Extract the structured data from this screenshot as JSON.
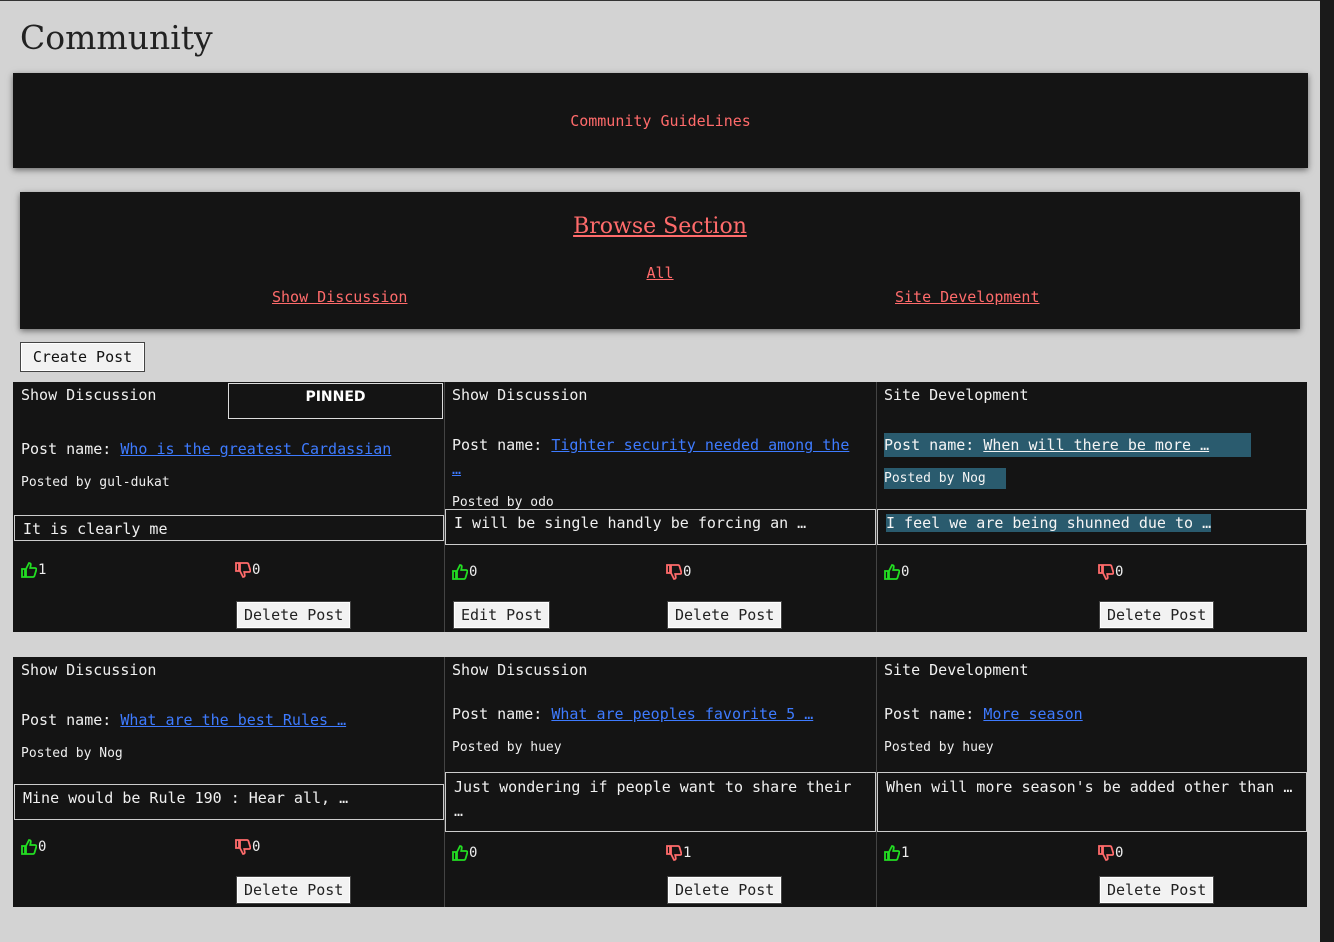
{
  "page": {
    "title": "Community",
    "guidelines_label": "Community GuideLines"
  },
  "browse": {
    "title": "Browse Section",
    "all_label": "All",
    "show_label": "Show Discussion",
    "site_label": "Site Development"
  },
  "create_post_label": "Create Post",
  "posts": [
    {
      "section": "Show Discussion",
      "pinned_label": "PINNED",
      "post_name_label": "Post name:",
      "name": "Who is the greatest Cardassian",
      "posted_by": "Posted by gul-dukat",
      "body": "It is clearly me",
      "likes": "1",
      "dislikes": "0",
      "delete_label": "Delete Post"
    },
    {
      "section": "Show Discussion",
      "post_name_label": "Post name:",
      "name": "Tighter security needed among the …",
      "posted_by": "Posted by odo",
      "body": "I will be single handly be forcing an …",
      "likes": "0",
      "dislikes": "0",
      "edit_label": "Edit Post",
      "delete_label": "Delete Post"
    },
    {
      "section": "Site Development",
      "post_name_label": "Post name:",
      "name": "When will there be more …",
      "posted_by": "Posted by Nog",
      "body": "I feel we are being shunned due to …",
      "likes": "0",
      "dislikes": "0",
      "delete_label": "Delete Post"
    },
    {
      "section": "Show Discussion",
      "post_name_label": "Post name:",
      "name": "What are the best Rules …",
      "posted_by": "Posted by Nog",
      "body": "Mine would be Rule 190 : Hear all, …",
      "likes": "0",
      "dislikes": "0",
      "delete_label": "Delete Post"
    },
    {
      "section": "Show Discussion",
      "post_name_label": "Post name:",
      "name": "What are peoples favorite 5 …",
      "posted_by": "Posted by huey",
      "body": "Just wondering if people want to share their …",
      "likes": "0",
      "dislikes": "1",
      "delete_label": "Delete Post"
    },
    {
      "section": "Site Development",
      "post_name_label": "Post name:",
      "name": "More season",
      "posted_by": "Posted by huey",
      "body": "When will more season's be added other than …",
      "likes": "1",
      "dislikes": "0",
      "delete_label": "Delete Post"
    }
  ],
  "colors": {
    "accent": "#ff6b6b",
    "link": "#3e7bff",
    "like": "#22dd22",
    "dislike": "#ff6b6b",
    "card_bg": "#141414",
    "page_bg": "#d3d3d3",
    "highlight": "#2a5b6e"
  },
  "icons": {
    "like": "thumbs-up-icon",
    "dislike": "thumbs-down-icon"
  }
}
